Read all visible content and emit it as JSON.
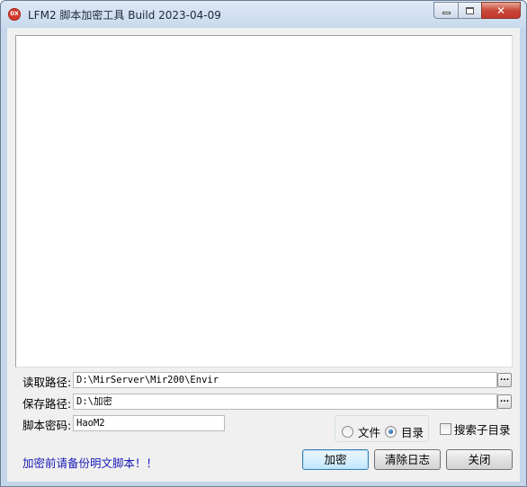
{
  "window": {
    "icon_text": "DX",
    "title": "LFM2 脚本加密工具 Build 2023-04-09"
  },
  "form": {
    "read_path_label": "读取路径:",
    "read_path_value": "D:\\MirServer\\Mir200\\Envir",
    "save_path_label": "保存路径:",
    "save_path_value": "D:\\加密",
    "password_label": "脚本密码:",
    "password_value": "HaoM2",
    "browse_label": "..."
  },
  "options": {
    "mode_file_label": "文件",
    "mode_dir_label": "目录",
    "selected_mode": "dir",
    "search_subdir_label": "搜索子目录",
    "search_subdir_checked": false
  },
  "notice": "加密前请备份明文脚本！！",
  "buttons": {
    "encrypt": "加密",
    "clear_log": "清除日志",
    "close": "关闭"
  },
  "colors": {
    "notice_text": "#1a1ab8",
    "close_button": "#c1372a"
  }
}
